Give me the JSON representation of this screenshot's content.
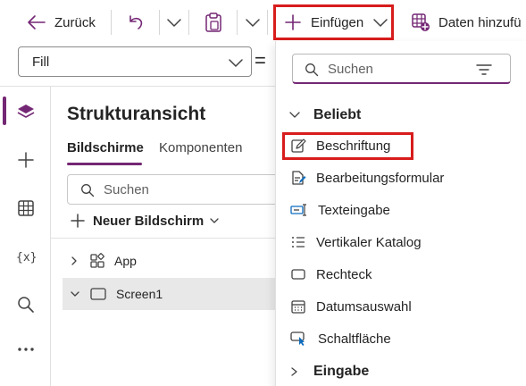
{
  "toolbar": {
    "back_label": "Zurück",
    "insert_label": "Einfügen",
    "add_data_label": "Daten hinzufü"
  },
  "formula_bar": {
    "property": "Fill",
    "equals": "="
  },
  "tree_view": {
    "title": "Strukturansicht",
    "tabs": [
      {
        "label": "Bildschirme",
        "active": true
      },
      {
        "label": "Komponenten",
        "active": false
      }
    ],
    "search_placeholder": "Suchen",
    "new_screen_label": "Neuer Bildschirm",
    "nodes": [
      {
        "label": "App",
        "expanded": false,
        "selected": false
      },
      {
        "label": "Screen1",
        "expanded": true,
        "selected": true
      }
    ]
  },
  "insert_flyout": {
    "search_placeholder": "Suchen",
    "groups": [
      {
        "label": "Beliebt",
        "expanded": true,
        "items": [
          {
            "label": "Beschriftung",
            "icon": "label-edit-icon",
            "highlighted": true
          },
          {
            "label": "Bearbeitungsformular",
            "icon": "edit-form-icon"
          },
          {
            "label": "Texteingabe",
            "icon": "text-input-icon"
          },
          {
            "label": "Vertikaler Katalog",
            "icon": "vertical-gallery-icon"
          },
          {
            "label": "Rechteck",
            "icon": "rectangle-icon"
          },
          {
            "label": "Datumsauswahl",
            "icon": "date-picker-icon"
          },
          {
            "label": "Schaltfläche",
            "icon": "button-icon"
          }
        ]
      },
      {
        "label": "Eingabe",
        "expanded": false,
        "items": []
      }
    ]
  },
  "colors": {
    "accent": "#742774",
    "highlight": "#d81c1c",
    "icon_blue": "#0f6cbd"
  }
}
